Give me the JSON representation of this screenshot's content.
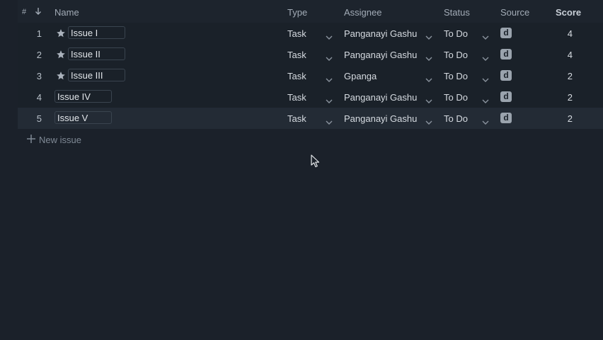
{
  "header": {
    "hash": "#",
    "name": "Name",
    "type": "Type",
    "assignee": "Assignee",
    "status": "Status",
    "source": "Source",
    "score": "Score"
  },
  "rows": [
    {
      "num": "1",
      "name": "Issue I",
      "starred": true,
      "type": "Task",
      "assignee": "Panganayi Gashu",
      "status": "To Do",
      "source": "d",
      "score": "4"
    },
    {
      "num": "2",
      "name": "Issue II",
      "starred": true,
      "type": "Task",
      "assignee": "Panganayi Gashu",
      "status": "To Do",
      "source": "d",
      "score": "4"
    },
    {
      "num": "3",
      "name": "Issue III",
      "starred": true,
      "type": "Task",
      "assignee": "Gpanga",
      "status": "To Do",
      "source": "d",
      "score": "2"
    },
    {
      "num": "4",
      "name": "Issue IV",
      "starred": false,
      "type": "Task",
      "assignee": "Panganayi Gashu",
      "status": "To Do",
      "source": "d",
      "score": "2"
    },
    {
      "num": "5",
      "name": "Issue V",
      "starred": false,
      "type": "Task",
      "assignee": "Panganayi Gashu",
      "status": "To Do",
      "source": "d",
      "score": "2"
    }
  ],
  "new_issue": {
    "label": "New issue"
  },
  "icons": {
    "star": "star-icon",
    "sort": "arrow-down-icon",
    "chevron": "chevron-down-icon",
    "add": "plus-icon",
    "source": "d-badge-icon"
  },
  "colors": {
    "background": "#1b212a",
    "header_bg": "#1d242d",
    "row_hover": "#232b35",
    "badge": "#9aa3ad",
    "muted": "#7f8995"
  }
}
